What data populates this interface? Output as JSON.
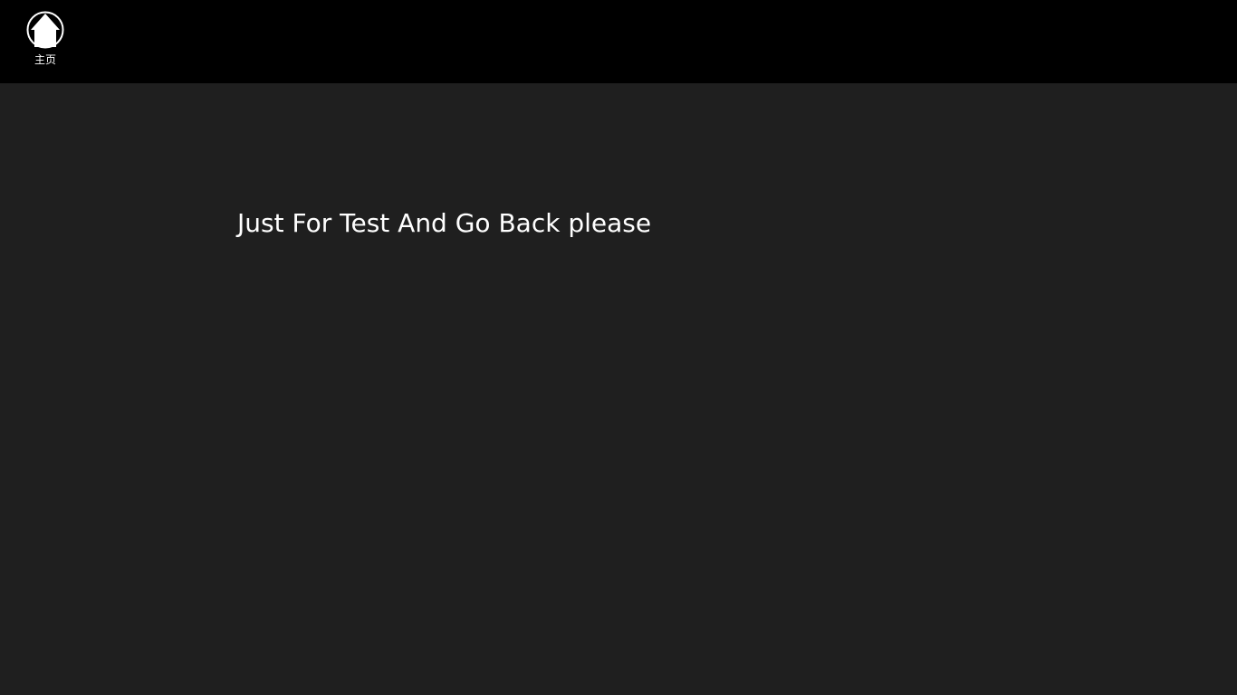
{
  "app_bar": {
    "home": {
      "label": "主页",
      "icon": "home-icon"
    }
  },
  "main": {
    "message": "Just For Test And Go Back please"
  },
  "colors": {
    "top_bar_background": "#000000",
    "page_background": "#1f1f1f",
    "text": "#ffffff"
  }
}
